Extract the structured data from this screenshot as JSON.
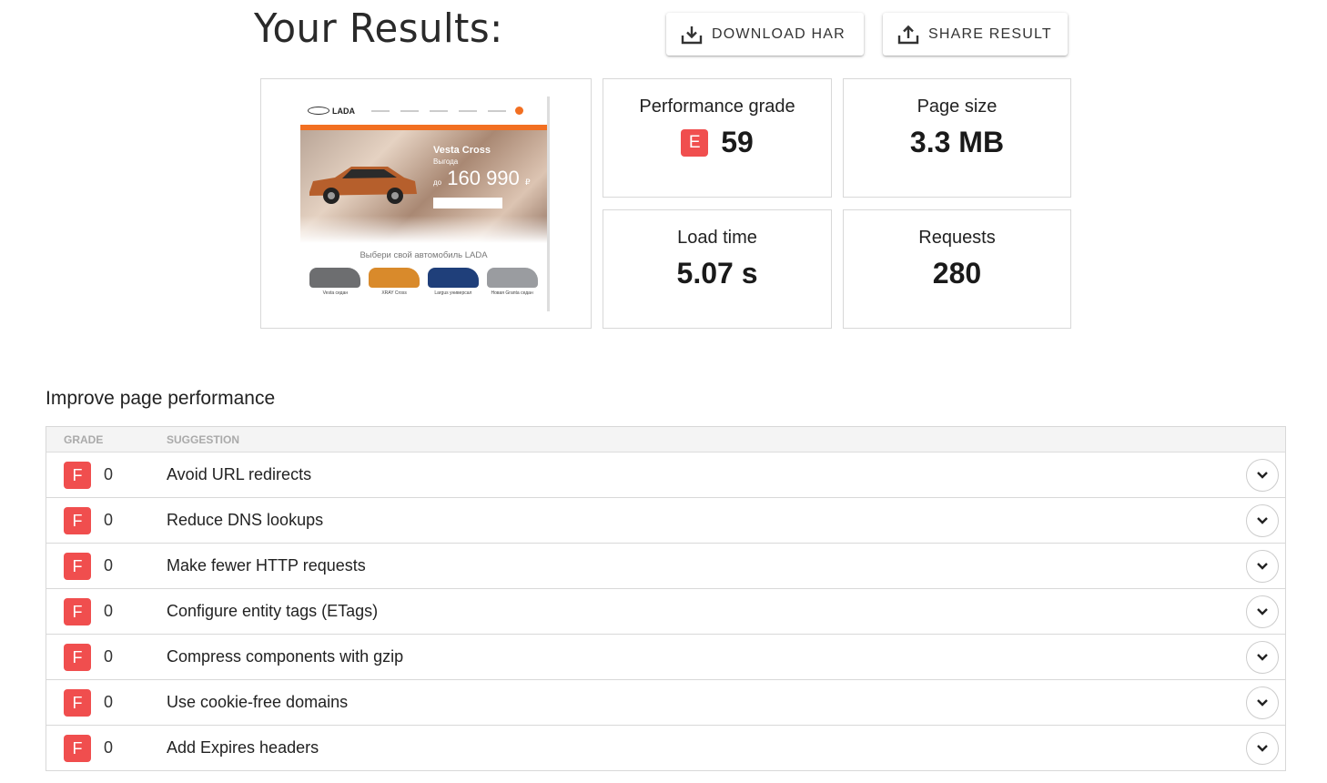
{
  "header": {
    "title": "Your Results:",
    "download_label": "DOWNLOAD HAR",
    "share_label": "SHARE RESULT"
  },
  "screenshot": {
    "brand": "LADA",
    "hero_model": "Vesta Cross",
    "hero_sub": "Выгода",
    "hero_price_prefix": "до",
    "hero_price": "160 990",
    "currency": "₽",
    "choose_text": "Выбери свой автомобиль LADA",
    "cars": [
      {
        "name": "Vesta седан",
        "color": "#6d6e70"
      },
      {
        "name": "XRAY Cross",
        "color": "#d98a2b"
      },
      {
        "name": "Largus универсал",
        "color": "#1f3f7a"
      },
      {
        "name": "Новая Granta седан",
        "color": "#9a9ca0"
      }
    ]
  },
  "metrics": {
    "performance": {
      "label": "Performance grade",
      "grade": "E",
      "value": "59"
    },
    "page_size": {
      "label": "Page size",
      "value": "3.3 MB"
    },
    "load_time": {
      "label": "Load time",
      "value": "5.07 s"
    },
    "requests": {
      "label": "Requests",
      "value": "280"
    }
  },
  "improve": {
    "title": "Improve page performance",
    "col_grade": "GRADE",
    "col_suggestion": "SUGGESTION",
    "rows": [
      {
        "grade": "F",
        "score": "0",
        "suggestion": "Avoid URL redirects"
      },
      {
        "grade": "F",
        "score": "0",
        "suggestion": "Reduce DNS lookups"
      },
      {
        "grade": "F",
        "score": "0",
        "suggestion": "Make fewer HTTP requests"
      },
      {
        "grade": "F",
        "score": "0",
        "suggestion": "Configure entity tags (ETags)"
      },
      {
        "grade": "F",
        "score": "0",
        "suggestion": "Compress components with gzip"
      },
      {
        "grade": "F",
        "score": "0",
        "suggestion": "Use cookie-free domains"
      },
      {
        "grade": "F",
        "score": "0",
        "suggestion": "Add Expires headers"
      }
    ]
  },
  "colors": {
    "grade_red": "#f04e4e",
    "brand_orange": "#f26f21"
  },
  "icons": {
    "download": "download-icon",
    "share": "share-icon",
    "expand": "chevron-down-icon"
  }
}
